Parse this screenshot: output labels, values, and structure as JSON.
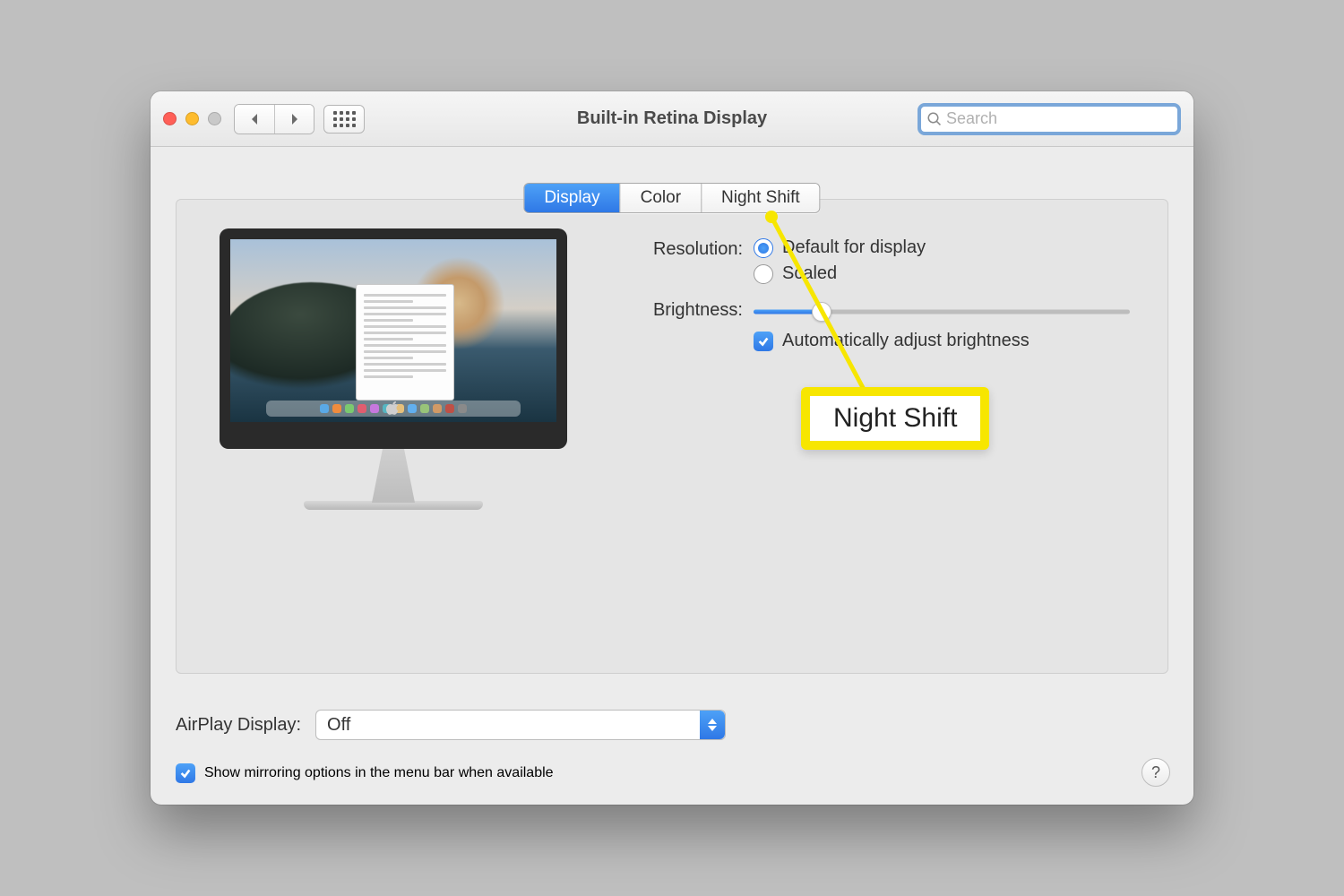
{
  "window": {
    "title": "Built-in Retina Display"
  },
  "search": {
    "placeholder": "Search"
  },
  "tabs": {
    "display": "Display",
    "color": "Color",
    "night_shift": "Night Shift"
  },
  "settings": {
    "resolution_label": "Resolution:",
    "resolution_options": {
      "default": "Default for display",
      "scaled": "Scaled"
    },
    "brightness_label": "Brightness:",
    "auto_brightness": "Automatically adjust brightness"
  },
  "callout": {
    "text": "Night Shift"
  },
  "airplay": {
    "label": "AirPlay Display:",
    "value": "Off"
  },
  "mirroring": {
    "label": "Show mirroring options in the menu bar when available"
  },
  "help": {
    "symbol": "?"
  }
}
